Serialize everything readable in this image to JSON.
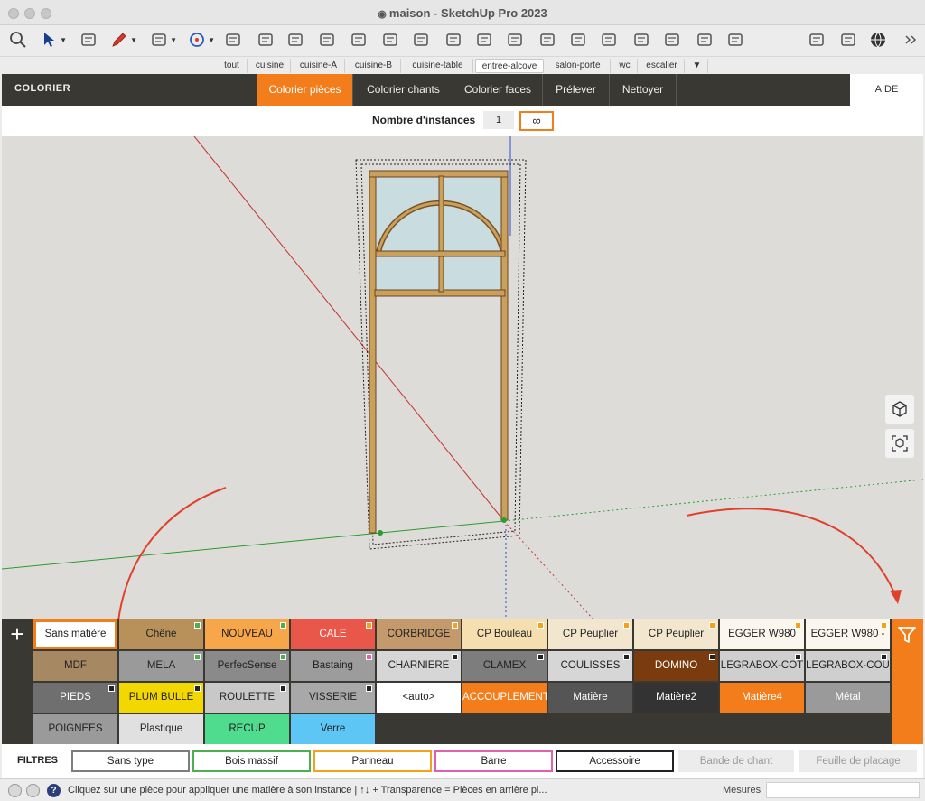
{
  "window": {
    "title": "maison - SketchUp Pro 2023"
  },
  "toolbar": {
    "icons": [
      "search-icon",
      "select-arrow-icon",
      "eraser-icon",
      "pencil-icon",
      "arc-icon",
      "circle-icon",
      "push-pull-icon",
      "follow-me-icon",
      "move-icon",
      "rotate-icon",
      "scale-icon",
      "section-icon",
      "paint-bucket-icon",
      "text-icon",
      "orbit-icon",
      "pan-icon",
      "hand-icon",
      "zoom-icon",
      "zoom-extents-icon",
      "extension-icon",
      "layers-icon",
      "stack-icon",
      "settings-stack-icon",
      "panel-icon",
      "dots-icon",
      "globe-icon",
      "more-icon"
    ]
  },
  "scenes": {
    "tabs": [
      "tout",
      "cuisine",
      "cuisine-A",
      "cuisine-B",
      "cuisine-table",
      "entree-alcove",
      "salon-porte",
      "wc",
      "escalier",
      "▼"
    ],
    "active": "entree-alcove"
  },
  "header": {
    "title": "COLORIER",
    "tabs": [
      "Colorier pièces",
      "Colorier chants",
      "Colorier faces",
      "Prélever",
      "Nettoyer"
    ],
    "active_tab": "Colorier pièces",
    "help": "AIDE"
  },
  "instances": {
    "label": "Nombre d'instances",
    "value": "1",
    "infinite": "∞"
  },
  "palette": {
    "add": "+",
    "rows": [
      [
        {
          "label": "Sans matière",
          "bg": "#ffffff",
          "fg": "#222",
          "selected": true
        },
        {
          "label": "Chêne",
          "bg": "#b8905a",
          "fg": "#222",
          "mark": "#4caf50"
        },
        {
          "label": "NOUVEAU",
          "bg": "#f7a64a",
          "fg": "#222",
          "mark": "#4caf50"
        },
        {
          "label": "CALE",
          "bg": "#e8574a",
          "fg": "#fff",
          "mark": "#f4a21b"
        },
        {
          "label": "CORBRIDGE",
          "bg": "#c49a6c",
          "fg": "#222",
          "mark": "#f4a21b"
        },
        {
          "label": "CP Bouleau",
          "bg": "#f5deb0",
          "fg": "#222",
          "mark": "#f4a21b"
        },
        {
          "label": "CP Peuplier",
          "bg": "#f3e6cf",
          "fg": "#222",
          "mark": "#f4a21b"
        },
        {
          "label": "CP Peuplier",
          "bg": "#f3e6cf",
          "fg": "#222",
          "mark": "#f4a21b"
        },
        {
          "label": "EGGER W980",
          "bg": "#fbf7ee",
          "fg": "#222",
          "mark": "#f4a21b"
        },
        {
          "label": "EGGER W980 -",
          "bg": "#fbf7ee",
          "fg": "#222",
          "mark": "#f4a21b"
        }
      ],
      [
        {
          "label": "MDF",
          "bg": "#a68863",
          "fg": "#222"
        },
        {
          "label": "MELA",
          "bg": "#9a9a9a",
          "fg": "#222",
          "mark": "#4caf50"
        },
        {
          "label": "PerfecSense",
          "bg": "#8a8a8a",
          "fg": "#222",
          "mark": "#4caf50"
        },
        {
          "label": "Bastaing",
          "bg": "#9c9c9c",
          "fg": "#222",
          "mark": "#e05fb0"
        },
        {
          "label": "CHARNIERE",
          "bg": "#d6d6d6",
          "fg": "#222",
          "mark": "#222"
        },
        {
          "label": "CLAMEX",
          "bg": "#7d7d7d",
          "fg": "#222",
          "mark": "#222"
        },
        {
          "label": "COULISSES",
          "bg": "#d6d6d6",
          "fg": "#222",
          "mark": "#222"
        },
        {
          "label": "DOMINO",
          "bg": "#7a3b0f",
          "fg": "#fff",
          "mark": "#222"
        },
        {
          "label": "LEGRABOX-COT",
          "bg": "#cfcfcf",
          "fg": "#222",
          "mark": "#222"
        },
        {
          "label": "LEGRABOX-COU",
          "bg": "#cfcfcf",
          "fg": "#222",
          "mark": "#222"
        }
      ],
      [
        {
          "label": "PIEDS",
          "bg": "#6f6f6f",
          "fg": "#fff",
          "mark": "#222"
        },
        {
          "label": "PLUM BULLE",
          "bg": "#f2d800",
          "fg": "#222",
          "mark": "#222"
        },
        {
          "label": "ROULETTE",
          "bg": "#c8c8c8",
          "fg": "#222",
          "mark": "#222"
        },
        {
          "label": "VISSERIE",
          "bg": "#a8a8a8",
          "fg": "#222",
          "mark": "#222"
        },
        {
          "label": "<auto>",
          "bg": "#ffffff",
          "fg": "#222"
        },
        {
          "label": "ACCOUPLEMENT",
          "bg": "#f47d1b",
          "fg": "#fff"
        },
        {
          "label": "Matière",
          "bg": "#555555",
          "fg": "#fff"
        },
        {
          "label": "Matière2",
          "bg": "#333333",
          "fg": "#fff"
        },
        {
          "label": "Matière4",
          "bg": "#f47d1b",
          "fg": "#fff"
        },
        {
          "label": "Métal",
          "bg": "#9a9a9a",
          "fg": "#fff"
        }
      ],
      [
        {
          "label": "POIGNEES",
          "bg": "#9a9a9a",
          "fg": "#222"
        },
        {
          "label": "Plastique",
          "bg": "#e0e0e0",
          "fg": "#222"
        },
        {
          "label": "RECUP",
          "bg": "#4fdc8f",
          "fg": "#222"
        },
        {
          "label": "Verre",
          "bg": "#5ec6f5",
          "fg": "#222"
        }
      ]
    ]
  },
  "filters": {
    "label": "FILTRES",
    "buttons": [
      {
        "label": "Sans type",
        "border": "#7d7d7d"
      },
      {
        "label": "Bois massif",
        "border": "#4caf50"
      },
      {
        "label": "Panneau",
        "border": "#f4a21b"
      },
      {
        "label": "Barre",
        "border": "#e05fb0"
      },
      {
        "label": "Accessoire",
        "border": "#222222"
      }
    ],
    "disabled": [
      "Bande de chant",
      "Feuille de placage"
    ]
  },
  "status": {
    "text": "Cliquez sur une pièce pour appliquer une matière à son instance | ↑↓ + Transparence = Pièces en arrière pl...",
    "measures_label": "Mesures",
    "measures_value": ""
  },
  "colors": {
    "accent": "#f47d1b",
    "header_bg": "#3a3833",
    "arrow": "#e0402b"
  }
}
